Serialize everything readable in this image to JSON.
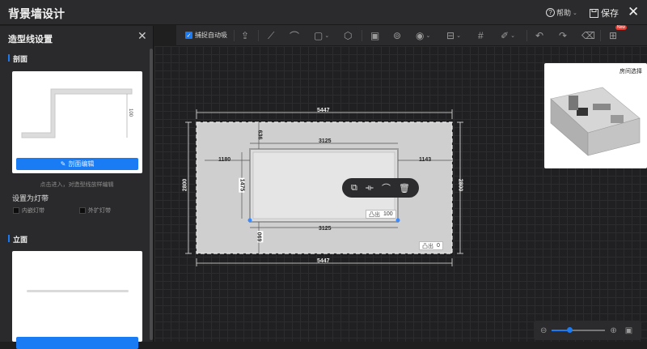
{
  "app": {
    "title": "背景墙设计",
    "help_label": "帮助",
    "save_label": "保存"
  },
  "panel": {
    "title": "造型线设置",
    "section_profile": "剖面",
    "profile_dim": "100",
    "profile_edit_btn": "剖面编辑",
    "profile_hint": "点击进入，对造型线放样编辑",
    "light_strip_title": "设置为灯带",
    "inner_strip": "内嵌灯带",
    "outer_strip": "外扩灯带",
    "section_elevation": "立面"
  },
  "toolbar": {
    "snap_label": "捕捉自动吸",
    "new_badge": "New"
  },
  "room_preview": {
    "label": "房间选择"
  },
  "canvas": {
    "width_top": "5447",
    "width_bottom": "5447",
    "height_left": "2800",
    "height_right": "2800",
    "inner_width_top": "3125",
    "inner_width_bottom": "3125",
    "left_gap": "1180",
    "right_gap": "1143",
    "top_gap": "636",
    "inner_height": "1475",
    "bottom_gap": "690",
    "protrude_label": "凸出",
    "protrude_inner": "100",
    "protrude_wall": "0"
  },
  "colors": {
    "accent": "#1a7cf5",
    "badge": "#e83a30"
  }
}
